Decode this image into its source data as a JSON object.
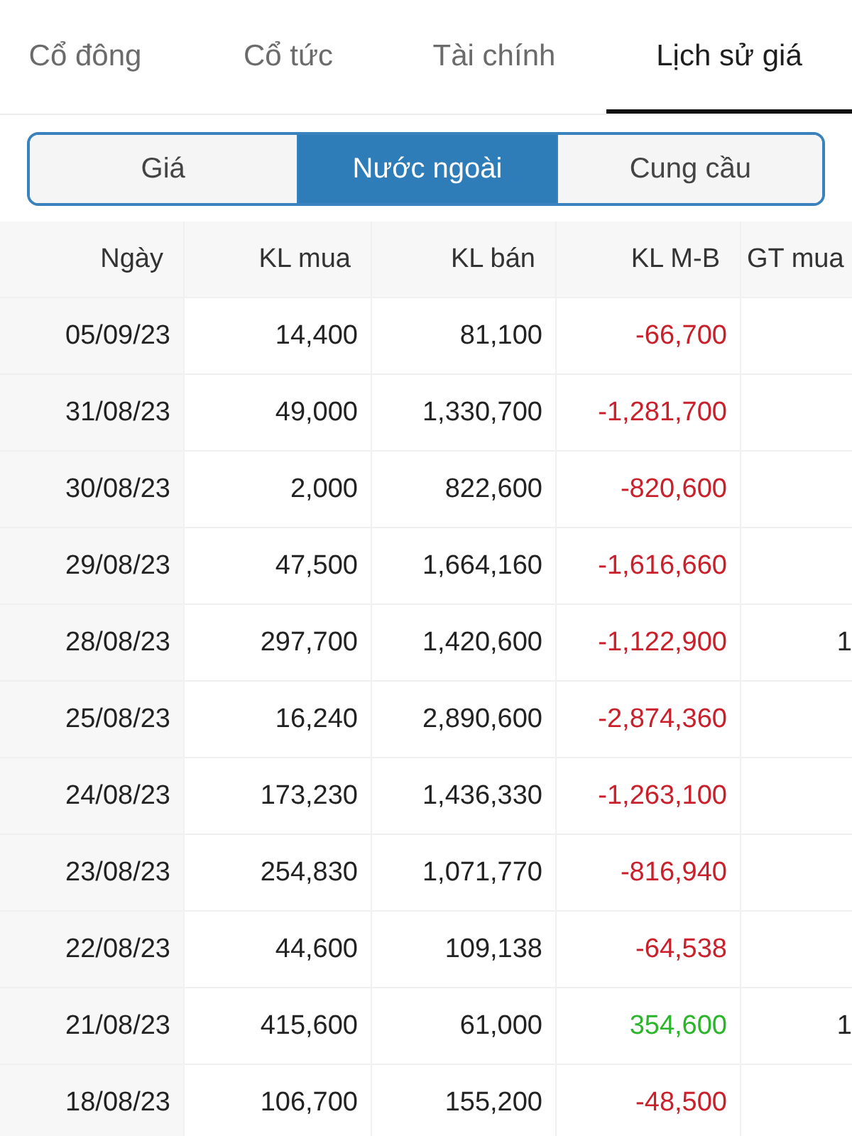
{
  "tabs": [
    {
      "label": "Cổ đông",
      "selected": false
    },
    {
      "label": "Cổ tức",
      "selected": false
    },
    {
      "label": "Tài chính",
      "selected": false
    },
    {
      "label": "Lịch sử giá",
      "selected": true
    }
  ],
  "segments": [
    {
      "label": "Giá",
      "selected": false
    },
    {
      "label": "Nước ngoài",
      "selected": true
    },
    {
      "label": "Cung cầu",
      "selected": false
    }
  ],
  "table": {
    "columns": [
      "Ngày",
      "KL mua",
      "KL bán",
      "KL M-B",
      "GT mua"
    ],
    "rows": [
      {
        "date": "05/09/23",
        "kl_mua": "14,400",
        "kl_ban": "81,100",
        "kl_mb": "-66,700",
        "color": "#c9202b"
      },
      {
        "date": "31/08/23",
        "kl_mua": "49,000",
        "kl_ban": "1,330,700",
        "kl_mb": "-1,281,700",
        "color": "#c9202b"
      },
      {
        "date": "30/08/23",
        "kl_mua": "2,000",
        "kl_ban": "822,600",
        "kl_mb": "-820,600",
        "color": "#c9202b"
      },
      {
        "date": "29/08/23",
        "kl_mua": "47,500",
        "kl_ban": "1,664,160",
        "kl_mb": "-1,616,660",
        "color": "#c9202b"
      },
      {
        "date": "28/08/23",
        "kl_mua": "297,700",
        "kl_ban": "1,420,600",
        "kl_mb": "-1,122,900",
        "color": "#c9202b",
        "gt_mua": "1"
      },
      {
        "date": "25/08/23",
        "kl_mua": "16,240",
        "kl_ban": "2,890,600",
        "kl_mb": "-2,874,360",
        "color": "#c9202b"
      },
      {
        "date": "24/08/23",
        "kl_mua": "173,230",
        "kl_ban": "1,436,330",
        "kl_mb": "-1,263,100",
        "color": "#c9202b"
      },
      {
        "date": "23/08/23",
        "kl_mua": "254,830",
        "kl_ban": "1,071,770",
        "kl_mb": "-816,940",
        "color": "#c9202b"
      },
      {
        "date": "22/08/23",
        "kl_mua": "44,600",
        "kl_ban": "109,138",
        "kl_mb": "-64,538",
        "color": "#c9202b"
      },
      {
        "date": "21/08/23",
        "kl_mua": "415,600",
        "kl_ban": "61,000",
        "kl_mb": "354,600",
        "color": "#2bb52b",
        "gt_mua": "1"
      },
      {
        "date": "18/08/23",
        "kl_mua": "106,700",
        "kl_ban": "155,200",
        "kl_mb": "-48,500",
        "color": "#c9202b"
      }
    ]
  }
}
